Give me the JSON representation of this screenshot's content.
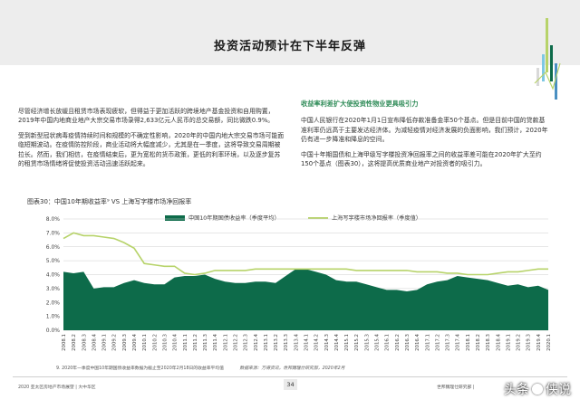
{
  "page": {
    "title": "投资活动预计在下半年反弹"
  },
  "left_column": {
    "paragraphs": [
      "尽管经济增长放缓且租赁市场表现疲软，但得益于更加活跃的跨境地产基金投资和自用购置，2019年中国内地商业地产大宗交易市场录得2,633亿元人民币的总交易额，同比微跌0.9%。",
      "受到新型冠状病毒疫情持续时间和规模的不确定性影响，2020年的中国内地大宗交易市场可能面临短期波动。在疫情防控阶段，商业活动将大幅度减少，尤其是在一季度，这将导致交易周期被拉长。然而，我们相信，在疫情结束后，更为宽松的货币政策，更低的利率环境，以及逐步复苏的租赁市场情绪将促使投资活动迅速活跃起来。"
    ]
  },
  "right_column": {
    "subheading": "收益率利差扩大使投资性物业更具吸引力",
    "paragraphs": [
      "中国人民银行在2020年1月1日宣布降低存款准备金率50个基点。但是目前中国的贷款基准利率仍远高于主要发达经济体。为减轻疫情对经济发展的负面影响，我们预计，2020年仍有进一步降准和降息的空间。",
      "中国十年期国债和上海甲级写字楼投资净回报率之间的收益率差可能在2020年扩大至约150个基点（图表30），这将提高优质商业地产对投资者的吸引力。"
    ]
  },
  "colors": {
    "bond_area": "#0d6b4a",
    "office_line": "#b7d36a",
    "grid": "#cfcfcf",
    "subhead": "#2e8b57"
  },
  "chart_data": {
    "type": "area",
    "title": "图表30：中国10年期收益率⁹ VS 上海写字楼市场净回报率",
    "ylim": [
      0,
      8
    ],
    "yticks": [
      "0.0%",
      "1.0%",
      "2.0%",
      "3.0%",
      "4.0%",
      "5.0%",
      "6.0%",
      "7.0%",
      "8.0%"
    ],
    "categories": [
      "2008.1",
      "2008.2",
      "2008.3",
      "2008.4",
      "2009.1",
      "2009.2",
      "2009.3",
      "2009.4",
      "2010.1",
      "2010.2",
      "2010.3",
      "2010.4",
      "2011.1",
      "2011.2",
      "2011.3",
      "2011.4",
      "2012.1",
      "2012.2",
      "2012.3",
      "2012.4",
      "2013.1",
      "2013.2",
      "2013.3",
      "2013.4",
      "2014.1",
      "2014.2",
      "2014.3",
      "2014.4",
      "2015.1",
      "2015.2",
      "2015.3",
      "2015.4",
      "2016.1",
      "2016.2",
      "2016.3",
      "2016.4",
      "2017.1",
      "2017.2",
      "2017.3",
      "2017.4",
      "2018.1",
      "2018.2",
      "2018.3",
      "2018.4",
      "2019.1",
      "2019.2",
      "2019.3",
      "2019.4",
      "2020.1"
    ],
    "series": [
      {
        "name": "中国10年期国债收益率（季度平均）",
        "style": "area",
        "values": [
          4.2,
          4.1,
          4.2,
          3.0,
          3.1,
          3.1,
          3.4,
          3.6,
          3.4,
          3.3,
          3.3,
          3.8,
          3.9,
          3.9,
          4.0,
          3.7,
          3.5,
          3.4,
          3.4,
          3.5,
          3.5,
          3.4,
          3.9,
          4.4,
          4.4,
          4.2,
          4.0,
          3.6,
          3.5,
          3.5,
          3.3,
          3.1,
          2.9,
          2.9,
          2.8,
          2.9,
          3.3,
          3.5,
          3.6,
          3.9,
          3.8,
          3.7,
          3.6,
          3.4,
          3.2,
          3.3,
          3.1,
          3.2,
          2.9
        ]
      },
      {
        "name": "上海写字楼市场净回报率（季度值）",
        "style": "line",
        "values": [
          6.6,
          7.0,
          6.8,
          6.8,
          6.7,
          6.6,
          6.3,
          5.9,
          4.8,
          4.7,
          4.6,
          4.6,
          4.1,
          4.0,
          4.1,
          4.3,
          4.3,
          4.3,
          4.3,
          4.4,
          4.4,
          4.4,
          4.4,
          4.4,
          4.4,
          4.4,
          4.4,
          4.4,
          4.4,
          4.3,
          4.3,
          4.3,
          4.3,
          4.3,
          4.3,
          4.2,
          4.2,
          4.2,
          4.1,
          4.1,
          4.0,
          4.0,
          4.0,
          4.1,
          4.2,
          4.2,
          4.3,
          4.4,
          4.4
        ]
      }
    ]
  },
  "footnote": {
    "text": "9. 2020年一季度中国10年期国债收益率数据为截止至2020年2月18日的收益率平均值",
    "source": "数据来源：万得资讯，世邦魏理仕研究部，2020年2月"
  },
  "footer": {
    "left": "2020 亚太区房地产市场展望 | 大中华区",
    "page_number": "34",
    "right": "世邦魏理仕研究部 |"
  },
  "watermark": {
    "left": "头条",
    "right": "侠说"
  }
}
